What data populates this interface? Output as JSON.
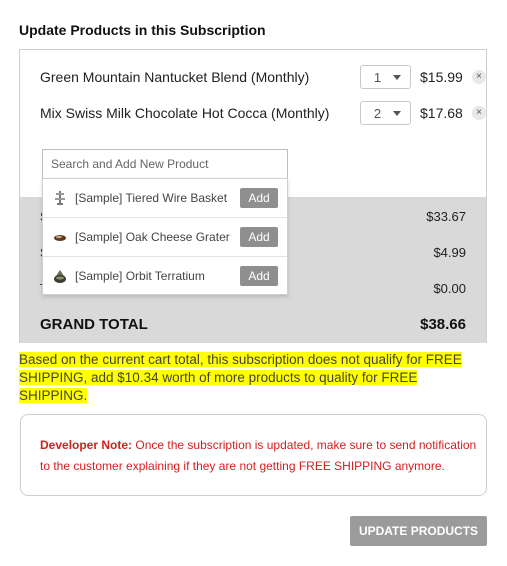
{
  "title": "Update Products in this Subscription",
  "products": [
    {
      "name": "Green Mountain Nantucket Blend (Monthly)",
      "qty": "1",
      "price": "$15.99",
      "remove": "×"
    },
    {
      "name": "Mix Swiss Milk Chocolate Hot Cocca (Monthly)",
      "qty": "2",
      "price": "$17.68",
      "remove": "×"
    }
  ],
  "search": {
    "placeholder": "Search and Add New Product",
    "results": [
      {
        "name": "[Sample] Tiered Wire Basket",
        "add_label": "Add"
      },
      {
        "name": "[Sample] Oak Cheese Grater",
        "add_label": "Add"
      },
      {
        "name": "[Sample] Orbit Terratium",
        "add_label": "Add"
      }
    ]
  },
  "totals": {
    "rows": [
      {
        "label": "S",
        "value": "$33.67"
      },
      {
        "label": "S",
        "value": "$4.99"
      },
      {
        "label": "T",
        "value": "$0.00"
      }
    ],
    "grand_label": "GRAND TOTAL",
    "grand_value": "$38.66"
  },
  "notice": "Based on the current cart total, this subscription does not qualify for FREE SHIPPING, add $10.34 worth of more products to quality for FREE SHIPPING.",
  "dev_note": {
    "label": "Developer Note:",
    "text": " Once the subscription is updated, make sure to send notification to the customer explaining if they are not getting FREE SHIPPING anymore."
  },
  "update_button": "UPDATE PRODUCTS",
  "colors": {
    "highlight": "#ffff00",
    "dev_note_text": "#d21f1f",
    "button_gray": "#9b9b9b",
    "totals_bg": "#d9d9d9"
  }
}
